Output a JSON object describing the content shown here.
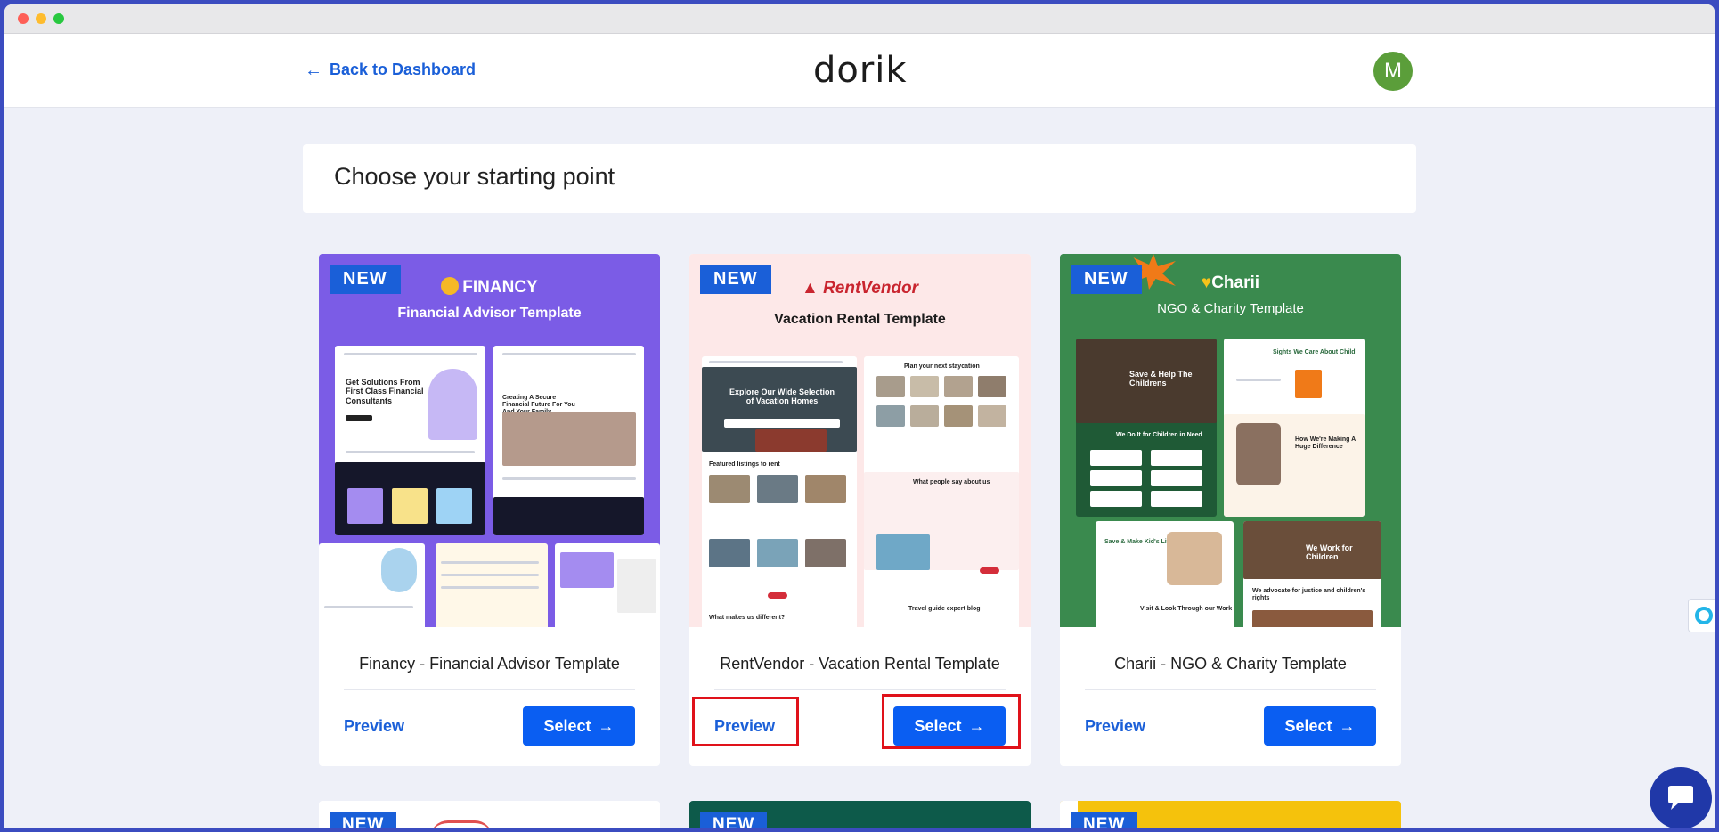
{
  "header": {
    "back_label": "Back to Dashboard",
    "logo_text": "dorik",
    "avatar_initial": "M"
  },
  "page": {
    "title": "Choose your starting point"
  },
  "templates": [
    {
      "badge": "NEW",
      "brand": "FINANCY",
      "subtitle": "Financial Advisor Template",
      "title": "Financy - Financial Advisor Template",
      "preview_label": "Preview",
      "select_label": "Select",
      "bg_color": "#7b5ce6"
    },
    {
      "badge": "NEW",
      "brand": "RentVendor",
      "subtitle": "Vacation Rental Template",
      "title": "RentVendor - Vacation Rental Template",
      "preview_label": "Preview",
      "select_label": "Select",
      "bg_color": "#fde8e8"
    },
    {
      "badge": "NEW",
      "brand": "Charii",
      "subtitle": "NGO & Charity Template",
      "title": "Charii - NGO & Charity Template",
      "preview_label": "Preview",
      "select_label": "Select",
      "bg_color": "#3a8a4e"
    }
  ],
  "next_row": [
    {
      "badge": "NEW",
      "bg_color": "#ffffff"
    },
    {
      "badge": "NEW",
      "bg_color": "#0d5a4a"
    },
    {
      "badge": "NEW",
      "bg_color": "#f5c20c"
    }
  ],
  "colors": {
    "accent": "#0a5ef2",
    "highlight": "#e0121a"
  }
}
